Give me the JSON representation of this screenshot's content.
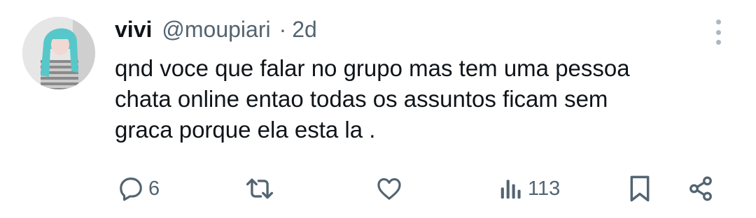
{
  "tweet": {
    "display_name": "vivi",
    "handle": "@moupiari",
    "separator": "·",
    "time": "2d",
    "text": "qnd voce que falar no grupo mas tem uma pessoa\nchata online entao todas os assuntos ficam sem\ngraca porque ela esta la ."
  },
  "actions": {
    "reply_count": "6",
    "retweet_count": "",
    "like_count": "",
    "views_count": "113"
  },
  "icons": {
    "reply": "reply-icon",
    "retweet": "retweet-icon",
    "like": "heart-icon",
    "views": "views-icon",
    "bookmark": "bookmark-icon",
    "share": "share-icon",
    "more": "more-vertical-icon"
  },
  "colors": {
    "text": "#0f1419",
    "secondary": "#536471",
    "dots": "#aab8c2"
  }
}
